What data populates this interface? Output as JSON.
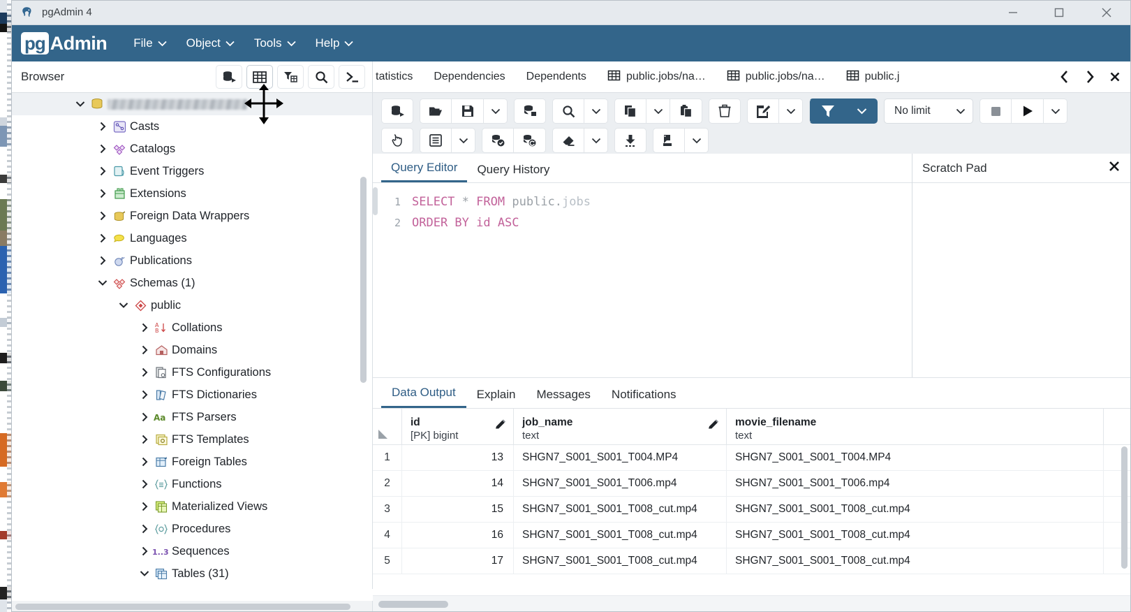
{
  "window": {
    "title": "pgAdmin 4",
    "app_icon": "elephant-icon",
    "minimize": "—",
    "maximize": "□",
    "close": "✕"
  },
  "menubar": {
    "brand_pg": "pg",
    "brand_admin": "Admin",
    "brand_color": "#33658a",
    "items": [
      {
        "label": "File",
        "caret": "⌄"
      },
      {
        "label": "Object",
        "caret": "⌄"
      },
      {
        "label": "Tools",
        "caret": "⌄"
      },
      {
        "label": "Help",
        "caret": "⌄"
      }
    ]
  },
  "browser": {
    "title": "Browser",
    "tools": [
      {
        "name": "query-tool-icon",
        "label": "Query Tool",
        "selected": false
      },
      {
        "name": "view-data-icon",
        "label": "View Data",
        "selected": true
      },
      {
        "name": "filtered-rows-icon",
        "label": "Filtered Rows",
        "selected": false
      },
      {
        "name": "search-icon",
        "label": "Search Objects",
        "selected": false
      },
      {
        "name": "psql-terminal-icon",
        "label": "PSQL Tool",
        "selected": false
      }
    ]
  },
  "tree": {
    "root": {
      "label": "",
      "redacted": true,
      "icon": "database-icon",
      "expanded": true
    },
    "items": [
      {
        "label": "Casts",
        "icon": "casts-icon",
        "indent": 1,
        "expanded": false
      },
      {
        "label": "Catalogs",
        "icon": "catalogs-icon",
        "indent": 1,
        "expanded": false
      },
      {
        "label": "Event Triggers",
        "icon": "event-triggers-icon",
        "indent": 1,
        "expanded": false
      },
      {
        "label": "Extensions",
        "icon": "extensions-icon",
        "indent": 1,
        "expanded": false
      },
      {
        "label": "Foreign Data Wrappers",
        "icon": "fdw-icon",
        "indent": 1,
        "expanded": false
      },
      {
        "label": "Languages",
        "icon": "languages-icon",
        "indent": 1,
        "expanded": false
      },
      {
        "label": "Publications",
        "icon": "publications-icon",
        "indent": 1,
        "expanded": false
      },
      {
        "label": "Schemas (1)",
        "icon": "schemas-icon",
        "indent": 1,
        "expanded": true
      },
      {
        "label": "public",
        "icon": "schema-icon",
        "indent": 2,
        "expanded": true
      },
      {
        "label": "Collations",
        "icon": "collations-icon",
        "indent": 3,
        "expanded": false
      },
      {
        "label": "Domains",
        "icon": "domains-icon",
        "indent": 3,
        "expanded": false
      },
      {
        "label": "FTS Configurations",
        "icon": "fts-configurations-icon",
        "indent": 3,
        "expanded": false
      },
      {
        "label": "FTS Dictionaries",
        "icon": "fts-dictionaries-icon",
        "indent": 3,
        "expanded": false
      },
      {
        "label": "FTS Parsers",
        "icon": "fts-parsers-icon",
        "indent": 3,
        "expanded": false
      },
      {
        "label": "FTS Templates",
        "icon": "fts-templates-icon",
        "indent": 3,
        "expanded": false
      },
      {
        "label": "Foreign Tables",
        "icon": "foreign-tables-icon",
        "indent": 3,
        "expanded": false
      },
      {
        "label": "Functions",
        "icon": "functions-icon",
        "indent": 3,
        "expanded": false
      },
      {
        "label": "Materialized Views",
        "icon": "materialized-views-icon",
        "indent": 3,
        "expanded": false
      },
      {
        "label": "Procedures",
        "icon": "procedures-icon",
        "indent": 3,
        "expanded": false
      },
      {
        "label": "Sequences",
        "icon": "sequences-icon",
        "indent": 3,
        "expanded": false
      },
      {
        "label": "Tables (31)",
        "icon": "tables-icon",
        "indent": 3,
        "expanded": true
      }
    ]
  },
  "tabstrip": {
    "tabs": [
      {
        "label": "tatistics",
        "icon": null,
        "truncated_left": true
      },
      {
        "label": "Dependencies",
        "icon": null
      },
      {
        "label": "Dependents",
        "icon": null
      },
      {
        "label": "public.jobs/na…",
        "icon": "table-icon"
      },
      {
        "label": "public.jobs/na…",
        "icon": "table-icon"
      },
      {
        "label": "public.j",
        "icon": "table-icon"
      }
    ],
    "nav": [
      {
        "name": "tab-prev-button",
        "glyph": "‹"
      },
      {
        "name": "tab-next-button",
        "glyph": "›"
      },
      {
        "name": "tab-close-button",
        "glyph": "✕"
      }
    ]
  },
  "query_toolbar": {
    "row1": [
      {
        "name": "open-query-tool-icon",
        "group": 1,
        "active": false,
        "selected": true
      },
      {
        "name": "open-file-icon",
        "group": 2
      },
      {
        "name": "save-file-icon",
        "group": 2
      },
      {
        "name": "save-dropdown-caret",
        "group": 2,
        "caret": true
      },
      {
        "name": "connection-status-icon",
        "group": 3
      },
      {
        "name": "find-icon",
        "group": 4
      },
      {
        "name": "find-dropdown-caret",
        "group": 4,
        "caret": true
      },
      {
        "name": "copy-icon",
        "group": 5
      },
      {
        "name": "copy-dropdown-caret",
        "group": 5,
        "caret": true
      },
      {
        "name": "paste-icon",
        "group": 5
      },
      {
        "name": "delete-icon",
        "group": 6
      },
      {
        "name": "edit-dropdown-icon",
        "group": 7
      },
      {
        "name": "edit-dropdown-caret",
        "group": 7,
        "caret": true
      },
      {
        "name": "filter-icon",
        "group": 8,
        "active": true
      },
      {
        "name": "filter-dropdown-caret",
        "group": 8,
        "active": true,
        "caret": true
      }
    ],
    "limit_label": "No limit",
    "limit_caret": "⌄",
    "stop_button": "stop-icon",
    "execute_button": "execute-play-icon",
    "execute_caret": "⌄",
    "row2": [
      {
        "name": "macros-icon",
        "group": 1
      },
      {
        "name": "explain-options-icon",
        "group": 2
      },
      {
        "name": "explain-dropdown-caret",
        "group": 2,
        "caret": true
      },
      {
        "name": "commit-icon",
        "group": 3
      },
      {
        "name": "rollback-icon",
        "group": 3
      },
      {
        "name": "clear-icon",
        "group": 4,
        "selected": true
      },
      {
        "name": "clear-dropdown-caret",
        "group": 4,
        "caret": true,
        "selected": true
      },
      {
        "name": "download-csv-icon",
        "group": 5,
        "selected": true
      },
      {
        "name": "graph-visualiser-icon",
        "group": 6
      },
      {
        "name": "graph-dropdown-caret",
        "group": 6,
        "caret": true
      }
    ]
  },
  "editor": {
    "tabs": [
      {
        "label": "Query Editor",
        "active": true
      },
      {
        "label": "Query History",
        "active": false
      }
    ],
    "lines": [
      {
        "number": "1",
        "tokens": [
          {
            "text": "SELECT",
            "type": "keyword"
          },
          {
            "text": " ",
            "type": "plain"
          },
          {
            "text": "*",
            "type": "operator"
          },
          {
            "text": " ",
            "type": "plain"
          },
          {
            "text": "FROM",
            "type": "keyword"
          },
          {
            "text": " ",
            "type": "plain"
          },
          {
            "text": "public.",
            "type": "schema"
          },
          {
            "text": "jobs",
            "type": "table"
          }
        ]
      },
      {
        "number": "2",
        "tokens": [
          {
            "text": "ORDER BY id ASC",
            "type": "keyword"
          }
        ]
      }
    ]
  },
  "scratch_pad": {
    "title": "Scratch Pad",
    "close_glyph": "✕",
    "content": ""
  },
  "output": {
    "tabs": [
      {
        "label": "Data Output",
        "active": true
      },
      {
        "label": "Explain",
        "active": false
      },
      {
        "label": "Messages",
        "active": false
      },
      {
        "label": "Notifications",
        "active": false
      }
    ],
    "columns": [
      {
        "name": "",
        "type": "",
        "key": "rownum"
      },
      {
        "name": "id",
        "type": "[PK] bigint",
        "key": "id",
        "editable": true
      },
      {
        "name": "job_name",
        "type": "text",
        "key": "job_name",
        "editable": true
      },
      {
        "name": "movie_filename",
        "type": "text",
        "key": "movie_filename",
        "editable": false
      }
    ],
    "rows": [
      {
        "rownum": "1",
        "id": "13",
        "job_name": "SHGN7_S001_S001_T004.MP4",
        "movie_filename": "SHGN7_S001_S001_T004.MP4"
      },
      {
        "rownum": "2",
        "id": "14",
        "job_name": "SHGN7_S001_S001_T006.mp4",
        "movie_filename": "SHGN7_S001_S001_T006.mp4"
      },
      {
        "rownum": "3",
        "id": "15",
        "job_name": "SHGN7_S001_S001_T008_cut.mp4",
        "movie_filename": "SHGN7_S001_S001_T008_cut.mp4"
      },
      {
        "rownum": "4",
        "id": "16",
        "job_name": "SHGN7_S001_S001_T008_cut.mp4",
        "movie_filename": "SHGN7_S001_S001_T008_cut.mp4"
      },
      {
        "rownum": "5",
        "id": "17",
        "job_name": "SHGN7_S001_S001_T008_cut.mp4",
        "movie_filename": "SHGN7_S001_S001_T008_cut.mp4"
      }
    ]
  }
}
